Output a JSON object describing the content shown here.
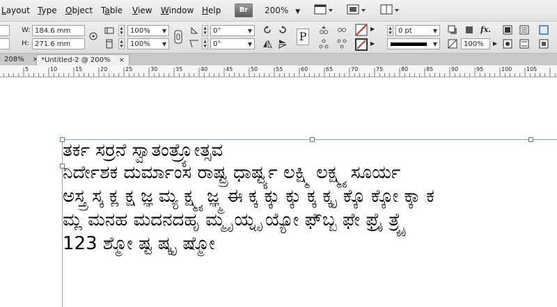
{
  "menu": [
    "Layout",
    "Type",
    "Object",
    "Table",
    "View",
    "Window",
    "Help"
  ],
  "menu_underline": [
    "L",
    "T",
    "O",
    "a",
    "V",
    "W",
    "H"
  ],
  "bridge_label": "Br",
  "zoom": "200%",
  "control": {
    "w_label": "W:",
    "w_value": "184.6 mm",
    "h_label": "H:",
    "h_value": "271.6 mm",
    "scale_x": "100%",
    "scale_y": "100%",
    "rotate": "0°",
    "shear": "0°",
    "stroke_weight": "0 pt",
    "opacity": "100%",
    "para_glyph": "P"
  },
  "tabs": {
    "first": "208%",
    "second": "*Untitled-2 @ 200%",
    "close": "×"
  },
  "ruler_labels": [
    "5",
    "10",
    "15",
    "20",
    "25",
    "30",
    "35",
    "40",
    "45",
    "50",
    "55",
    "60",
    "65",
    "70",
    "75",
    "80",
    "85",
    "90",
    "95",
    "100",
    "105"
  ],
  "document_lines": [
    "ತರ್ಕ ಸರ್ರನೆ ಸ್ವಾತಂತ್ರ್ಯೋತ್ಸವ",
    "ನಿರ್ದೇಶಕ ದುರ್ಮಾಂಸ ರಾಷ್ಟ್ರ ಧಾರ್ಷ್ಟ್ಯ ಲಕ್ಷ್ಮಿ ಲಕ್ಷ್ಮ್ಯ ಸೂರ್ಯ",
    "ಅಸ್ತ್ರ ಸ್ಕ ಕ್ಲ ಕ್ಷ ಜ್ಞ ಮ್ಯ ಕ್ಷ್ಮ್ಯ ಜ್ಞ್ಮ ಈ ಕ್ಕ ಕ್ಕು ಕ್ಕು ಕ್ಕ ಕ್ಕೃ ಕ್ಕೊ ಕ್ಕೋ ಕ್ಕಾ ಕ",
    "ಮ್ಲ ಮನಹ ಮದನದಹೃ ಮ್ಮೃ ಯ್ನೃ ಯ್ಯೋ ಫೆ್ಬ್ಬ ಫೇ ಫ್ರೈ ತ್ರ್ಯೈ",
    "123 ಶ್ಮೋ ಷ್ಟ ಷ್ಕೃ ಷ್ಮೋ"
  ],
  "colors": {
    "frame_border": "#8aa3c8",
    "handle_border": "#5878a8",
    "stroke_red": "#c0392b"
  }
}
